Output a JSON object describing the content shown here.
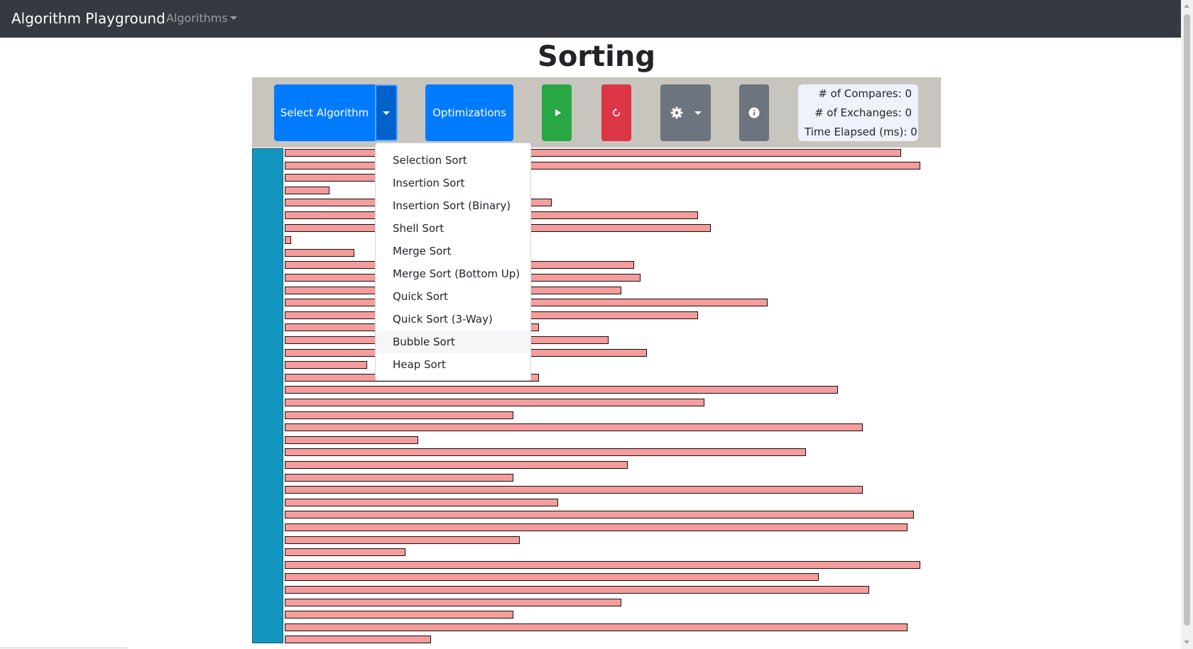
{
  "navbar": {
    "brand": "Algorithm Playground",
    "dropdown_label": "Algorithms"
  },
  "page": {
    "title": "Sorting"
  },
  "toolbar": {
    "select_algorithm_label": "Select Algorithm",
    "optimizations_label": "Optimizations",
    "icons": {
      "toggle": "caret-down-icon",
      "play": "play-icon",
      "reset": "reset-icon",
      "settings": "gear-icon",
      "info": "info-icon"
    },
    "colors": {
      "primary": "#007bff",
      "success": "#28a745",
      "danger": "#dc3545",
      "secondary": "#6c757d"
    }
  },
  "stats": {
    "compares_label": "# of Compares:",
    "compares_value": "0",
    "exchanges_label": "# of Exchanges:",
    "exchanges_value": "0",
    "time_label": "Time Elapsed (ms):",
    "time_value": "0"
  },
  "algorithm_menu": {
    "items": [
      "Selection Sort",
      "Insertion Sort",
      "Insertion Sort (Binary)",
      "Shell Sort",
      "Merge Sort",
      "Merge Sort (Bottom Up)",
      "Quick Sort",
      "Quick Sort (3-Way)",
      "Bubble Sort",
      "Heap Sort"
    ],
    "hovered": "Bubble Sort"
  },
  "array": {
    "max": 100,
    "values": [
      97,
      100,
      36,
      7,
      42,
      65,
      67,
      1,
      11,
      55,
      56,
      53,
      76,
      65,
      40,
      51,
      57,
      13,
      40,
      87,
      66,
      36,
      91,
      21,
      82,
      54,
      36,
      91,
      43,
      99,
      98,
      37,
      19,
      100,
      84,
      92,
      53,
      36,
      98,
      23
    ],
    "bar_color": "#f59c9c",
    "sidebar_color": "#1296bf"
  }
}
